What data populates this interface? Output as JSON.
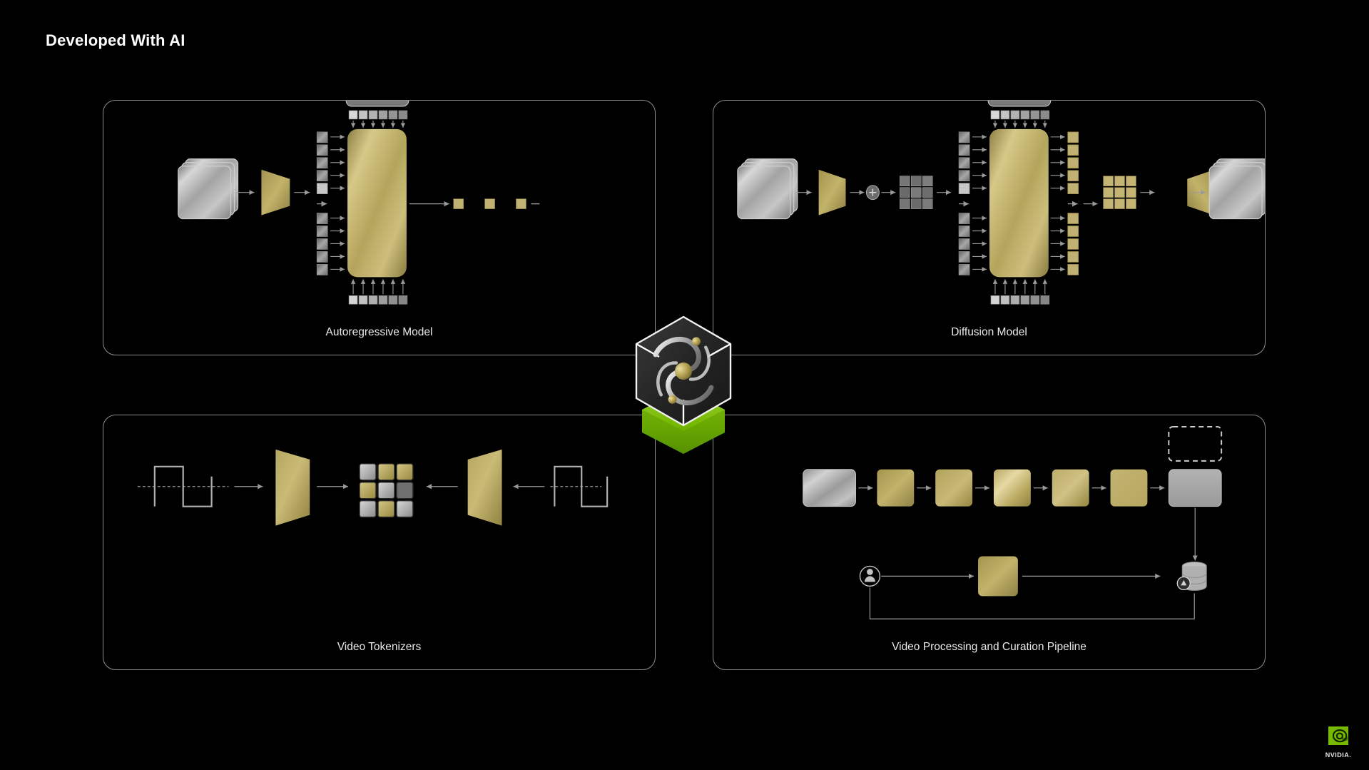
{
  "page": {
    "title": "Developed With AI",
    "background_color": "#000000",
    "accent_gold": "#c3b473",
    "accent_silver": "#b8b8b8",
    "nvidia_green": "#76b900"
  },
  "panels": [
    {
      "id": "autoregressive",
      "caption": "Autoregressive Model",
      "elements": [
        "input-frame-stack",
        "encoder-trapezoid",
        "token-columns",
        "transformer-block",
        "top-token-strip",
        "bottom-token-strip",
        "output-token-sequence"
      ]
    },
    {
      "id": "diffusion",
      "caption": "Diffusion Model",
      "elements": [
        "input-frame-stack",
        "encoder-trapezoid",
        "noise-add-node",
        "noisy-latent-grid",
        "token-columns",
        "transformer-block",
        "top-token-strip",
        "bottom-token-strip",
        "output-token-columns",
        "denoised-latent-grid",
        "decoder-trapezoid",
        "output-frame-stack"
      ]
    },
    {
      "id": "tokenizers",
      "caption": "Video Tokenizers",
      "elements": [
        "input-waveform",
        "encoder-trapezoid",
        "latent-cube-grid",
        "decoder-trapezoid",
        "output-waveform"
      ]
    },
    {
      "id": "pipeline",
      "caption": "Video Processing and Curation Pipeline",
      "elements": [
        "source-video-tile",
        "processing-stage-1",
        "processing-stage-2",
        "processing-stage-3",
        "processing-stage-4",
        "processing-stage-5",
        "output-video-tile",
        "dashed-placeholder-tile",
        "human-annotator-icon",
        "annotation-stage",
        "database-icon",
        "feedback-loop"
      ]
    }
  ],
  "center_badge": {
    "name": "cosmos-cube-logo",
    "description": "galaxy spiral in dark hexagonal cube on green base",
    "base_color": "#76b900",
    "cube_color": "#2b2b2b"
  },
  "brand": {
    "logo_name": "nvidia-logo",
    "wordmark": "NVIDIA."
  }
}
